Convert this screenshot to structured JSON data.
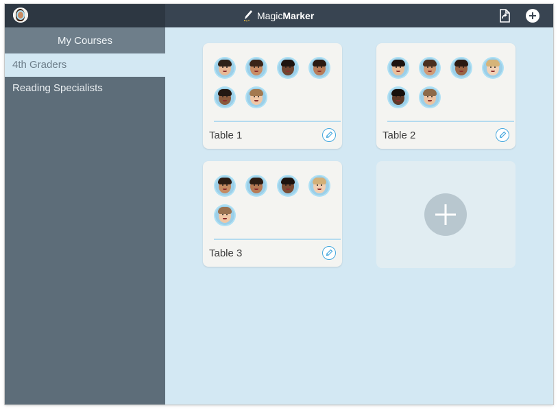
{
  "app": {
    "brand_light": "Magic",
    "brand_bold": "Marker",
    "pen_icon": "marker-pen-icon",
    "share_icon": "export-document-icon",
    "add_icon": "add-circle-icon"
  },
  "sidebar": {
    "header": "My Courses",
    "items": [
      {
        "label": "4th Graders",
        "active": true
      },
      {
        "label": "Reading Specialists",
        "active": false
      }
    ]
  },
  "tables": [
    {
      "title": "Table 1",
      "students": 6
    },
    {
      "title": "Table 2",
      "students": 6
    },
    {
      "title": "Table 3",
      "students": 5
    }
  ],
  "add_table": {
    "icon": "plus-icon"
  },
  "colors": {
    "topbar": "#384451",
    "sidebar": "#5d6d79",
    "content_bg": "#d3e8f3",
    "accent": "#45a8de"
  }
}
